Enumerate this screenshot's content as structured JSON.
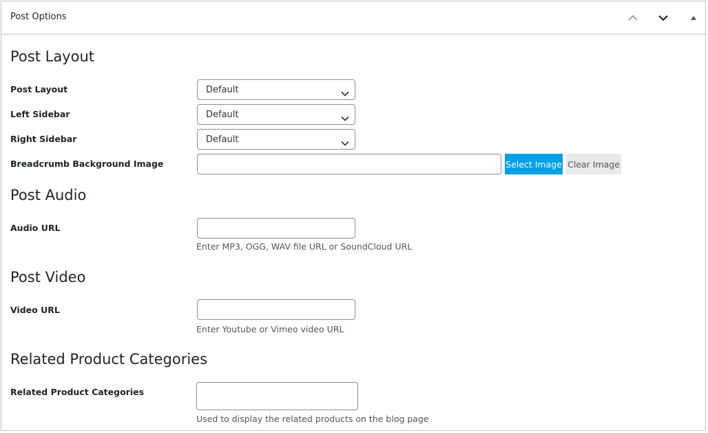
{
  "panel": {
    "title": "Post Options",
    "controls": [
      "move-up-icon",
      "move-down-icon",
      "toggle-panel-icon"
    ]
  },
  "sections": {
    "layout": {
      "title": "Post Layout",
      "fields": {
        "post_layout": {
          "label": "Post Layout",
          "value": "Default"
        },
        "left_sidebar": {
          "label": "Left Sidebar",
          "value": "Default"
        },
        "right_sidebar": {
          "label": "Right Sidebar",
          "value": "Default"
        },
        "breadcrumb_bg": {
          "label": "Breadcrumb Background Image",
          "value": "",
          "select_label": "Select Image",
          "clear_label": "Clear Image"
        }
      }
    },
    "audio": {
      "title": "Post Audio",
      "label": "Audio URL",
      "value": "",
      "help": "Enter MP3, OGG, WAV file URL or SoundCloud URL"
    },
    "video": {
      "title": "Post Video",
      "label": "Video URL",
      "value": "",
      "help": "Enter Youtube or Vimeo video URL"
    },
    "related": {
      "title": "Related Product Categories",
      "label": "Related Product Categories",
      "value": "",
      "help": "Used to display the related products on the blog page"
    }
  },
  "colors": {
    "primary_button": "#00a0e8",
    "secondary_button": "#e9e9e9",
    "border": "#c3c4c7"
  }
}
